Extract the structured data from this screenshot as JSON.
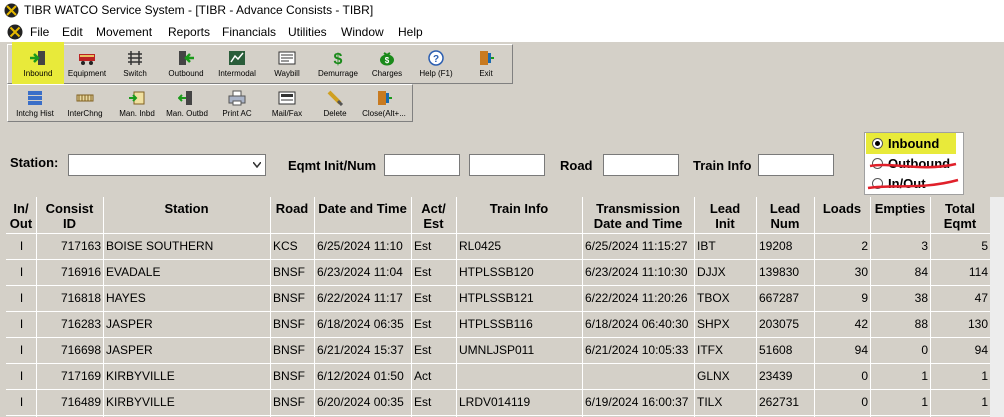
{
  "window": {
    "title": "TIBR WATCO Service System - [TIBR - Advance Consists - TIBR]"
  },
  "menu": [
    "File",
    "Edit",
    "Movement",
    "Reports",
    "Financials",
    "Utilities",
    "Window",
    "Help"
  ],
  "toolbar1": [
    {
      "label": "Inbound",
      "icon": "inbound-icon"
    },
    {
      "label": "Equipment",
      "icon": "equipment-icon"
    },
    {
      "label": "Switch",
      "icon": "switch-icon"
    },
    {
      "label": "Outbound",
      "icon": "outbound-icon"
    },
    {
      "label": "Intermodal",
      "icon": "intermodal-icon"
    },
    {
      "label": "Waybill",
      "icon": "waybill-icon"
    },
    {
      "label": "Demurrage",
      "icon": "demurrage-icon"
    },
    {
      "label": "Charges",
      "icon": "charges-icon"
    },
    {
      "label": "Help (F1)",
      "icon": "help-icon"
    },
    {
      "label": "Exit",
      "icon": "exit-icon"
    }
  ],
  "toolbar2": [
    {
      "label": "Intchg Hist",
      "icon": "interchange-history-icon"
    },
    {
      "label": "InterChng",
      "icon": "interchange-icon"
    },
    {
      "label": "Man. Inbd",
      "icon": "manual-inbound-icon"
    },
    {
      "label": "Man. Outbd",
      "icon": "manual-outbound-icon"
    },
    {
      "label": "Print AC",
      "icon": "print-icon"
    },
    {
      "label": "Mail/Fax",
      "icon": "mail-fax-icon"
    },
    {
      "label": "Delete",
      "icon": "delete-icon"
    },
    {
      "label": "Close(Alt+...",
      "icon": "close-icon"
    }
  ],
  "filters": {
    "station_label": "Station:",
    "station_value": "",
    "eqmt_label": "Eqmt Init/Num",
    "eqmt_init": "",
    "eqmt_num": "",
    "road_label": "Road",
    "road_value": "",
    "train_label": "Train Info",
    "train_value": ""
  },
  "radio": {
    "options": [
      "Inbound",
      "Outbound",
      "In/Out"
    ],
    "selected": "Inbound"
  },
  "colors": {
    "highlight": "#e8ea3a",
    "annotation": "#e0202a"
  },
  "table": {
    "headers": [
      "In/\nOut",
      "Consist\nID",
      "Station",
      "Road",
      "Date and Time",
      "Act/\nEst",
      "Train Info",
      "Transmission\nDate and Time",
      "Lead\nInit",
      "Lead\nNum",
      "Loads",
      "Empties",
      "Total\nEqmt"
    ],
    "rows": [
      [
        "I",
        "717163",
        "BOISE SOUTHERN",
        "KCS",
        "6/25/2024 11:10",
        "Est",
        "RL0425",
        "6/25/2024 11:15:27",
        "IBT",
        "19208",
        "2",
        "3",
        "5"
      ],
      [
        "I",
        "716916",
        "EVADALE",
        "BNSF",
        "6/23/2024 11:04",
        "Est",
        "HTPLSSB120",
        "6/23/2024 11:10:30",
        "DJJX",
        "139830",
        "30",
        "84",
        "114"
      ],
      [
        "I",
        "716818",
        "HAYES",
        "BNSF",
        "6/22/2024 11:17",
        "Est",
        "HTPLSSB121",
        "6/22/2024 11:20:26",
        "TBOX",
        "667287",
        "9",
        "38",
        "47"
      ],
      [
        "I",
        "716283",
        "JASPER",
        "BNSF",
        "6/18/2024 06:35",
        "Est",
        "HTPLSSB116",
        "6/18/2024 06:40:30",
        "SHPX",
        "203075",
        "42",
        "88",
        "130"
      ],
      [
        "I",
        "716698",
        "JASPER",
        "BNSF",
        "6/21/2024 15:37",
        "Est",
        "UMNLJSP011",
        "6/21/2024 10:05:33",
        "ITFX",
        "51608",
        "94",
        "0",
        "94"
      ],
      [
        "I",
        "717169",
        "KIRBYVILLE",
        "BNSF",
        "6/12/2024 01:50",
        "Act",
        "",
        "",
        "GLNX",
        "23439",
        "0",
        "1",
        "1"
      ],
      [
        "I",
        "716489",
        "KIRBYVILLE",
        "BNSF",
        "6/20/2024 00:35",
        "Est",
        "LRDV014119",
        "6/19/2024 16:00:37",
        "TILX",
        "262731",
        "0",
        "1",
        "1"
      ]
    ]
  }
}
